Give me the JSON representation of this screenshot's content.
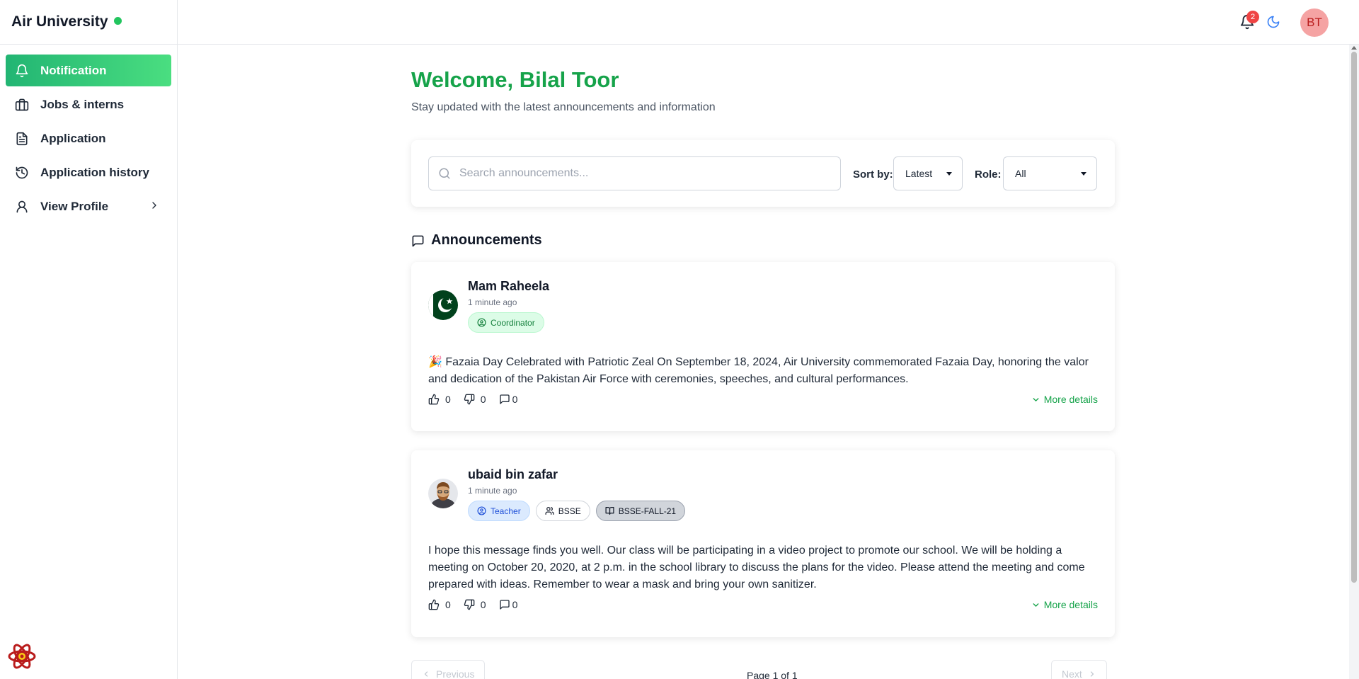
{
  "brand": {
    "name": "Air University"
  },
  "nav": {
    "items": [
      {
        "label": "Notification",
        "icon": "bell-icon",
        "active": true
      },
      {
        "label": "Jobs & interns",
        "icon": "briefcase-icon",
        "active": false
      },
      {
        "label": "Application",
        "icon": "document-icon",
        "active": false
      },
      {
        "label": "Application history",
        "icon": "history-icon",
        "active": false
      },
      {
        "label": "View Profile",
        "icon": "user-icon",
        "active": false
      }
    ]
  },
  "topbar": {
    "notification_count": "2",
    "user_initials": "BT"
  },
  "main": {
    "welcome": "Welcome, Bilal Toor",
    "subtitle": "Stay updated with the latest announcements and information"
  },
  "filters": {
    "search_placeholder": "Search announcements...",
    "sort_label": "Sort by:",
    "sort_value": "Latest",
    "role_label": "Role:",
    "role_value": "All"
  },
  "announcements": {
    "heading": "Announcements",
    "items": [
      {
        "author": "Mam Raheela",
        "time": "1 minute ago",
        "role": "Coordinator",
        "body": "🎉 Fazaia Day Celebrated with Patriotic Zeal On September 18, 2024, Air University commemorated Fazaia Day, honoring the valor and dedication of the Pakistan Air Force with ceremonies, speeches, and cultural performances.",
        "likes": "0",
        "dislikes": "0",
        "comments": "0",
        "more": "More details"
      },
      {
        "author": "ubaid bin zafar",
        "time": "1 minute ago",
        "role": "Teacher",
        "department": "BSSE",
        "section": "BSSE-FALL-21",
        "body": "I hope this message finds you well. Our class will be participating in a video project to promote our school. We will be holding a meeting on October 20, 2020, at 2 p.m. in the school library to discuss the plans for the video. Please attend the meeting and come prepared with ideas. Remember to wear a mask and bring your own sanitizer.",
        "likes": "0",
        "dislikes": "0",
        "comments": "0",
        "more": "More details"
      }
    ]
  },
  "pagination": {
    "previous": "Previous",
    "page_info": "Page 1 of 1",
    "next": "Next"
  },
  "colors": {
    "accent": "#16a34a",
    "accent_gradient_start": "#22b573",
    "accent_gradient_end": "#4ade80",
    "badge": "#ef4444"
  }
}
